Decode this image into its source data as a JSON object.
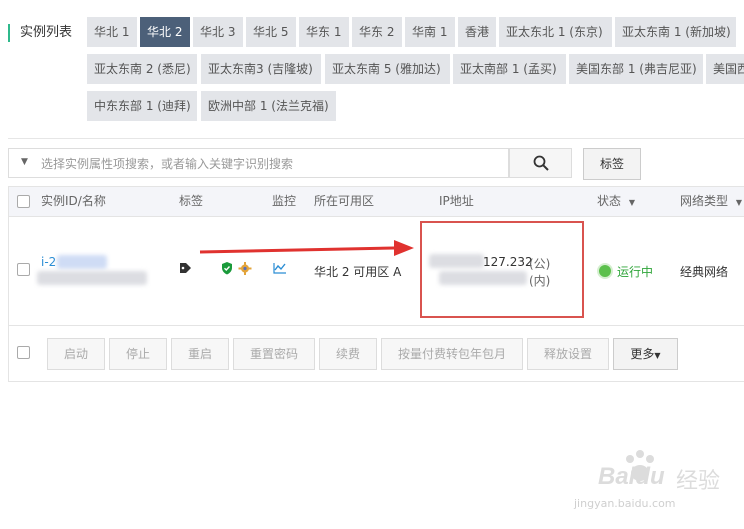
{
  "page": {
    "title": "实例列表"
  },
  "regions": [
    {
      "label": "华北 1"
    },
    {
      "label": "华北 2"
    },
    {
      "label": "华北 3"
    },
    {
      "label": "华北 5"
    },
    {
      "label": "华东 1"
    },
    {
      "label": "华东 2"
    },
    {
      "label": "华南 1"
    },
    {
      "label": "香港"
    },
    {
      "label": "亚太东北 1 (东京)"
    },
    {
      "label": "亚太东南 1 (新加坡)"
    },
    {
      "label": "亚太东南 2 (悉尼)"
    },
    {
      "label": "亚太东南3 (吉隆坡)"
    },
    {
      "label": "亚太东南 5 (雅加达)"
    },
    {
      "label": "亚太南部 1 (孟买)"
    },
    {
      "label": "美国东部 1 (弗吉尼亚)"
    },
    {
      "label": "美国西"
    },
    {
      "label": "中东东部 1 (迪拜)"
    },
    {
      "label": "欧洲中部 1 (法兰克福)"
    }
  ],
  "active_region": "华北 2",
  "search": {
    "placeholder": "选择实例属性项搜索，或者输入关键字识别搜索"
  },
  "tag_button": "标签",
  "columns": {
    "instance": "实例ID/名称",
    "tags": "标签",
    "monitor": "监控",
    "zone": "所在可用区",
    "ip": "IP地址",
    "status": "状态",
    "network": "网络类型"
  },
  "row": {
    "instance_id_prefix": "i-2",
    "zone": "华北 2 可用区 A",
    "ip_public_suffix": "127.232",
    "ip_public_tag": "(公)",
    "ip_private_tag": "(内)",
    "status": "运行中",
    "network": "经典网络"
  },
  "actions": {
    "start": "启动",
    "stop": "停止",
    "restart": "重启",
    "reset_password": "重置密码",
    "renew": "续费",
    "convert": "按量付费转包年包月",
    "release": "释放设置",
    "more": "更多"
  },
  "colors": {
    "accent": "#2fb98c",
    "active_tab": "#4c6079",
    "highlight_box": "#d9534f",
    "arrow": "#e0322f",
    "status_running": "#5cc04c",
    "link": "#2a8dd4"
  },
  "watermark": {
    "brand": "Baidu",
    "suffix": "经验",
    "url": "jingyan.baidu.com"
  }
}
